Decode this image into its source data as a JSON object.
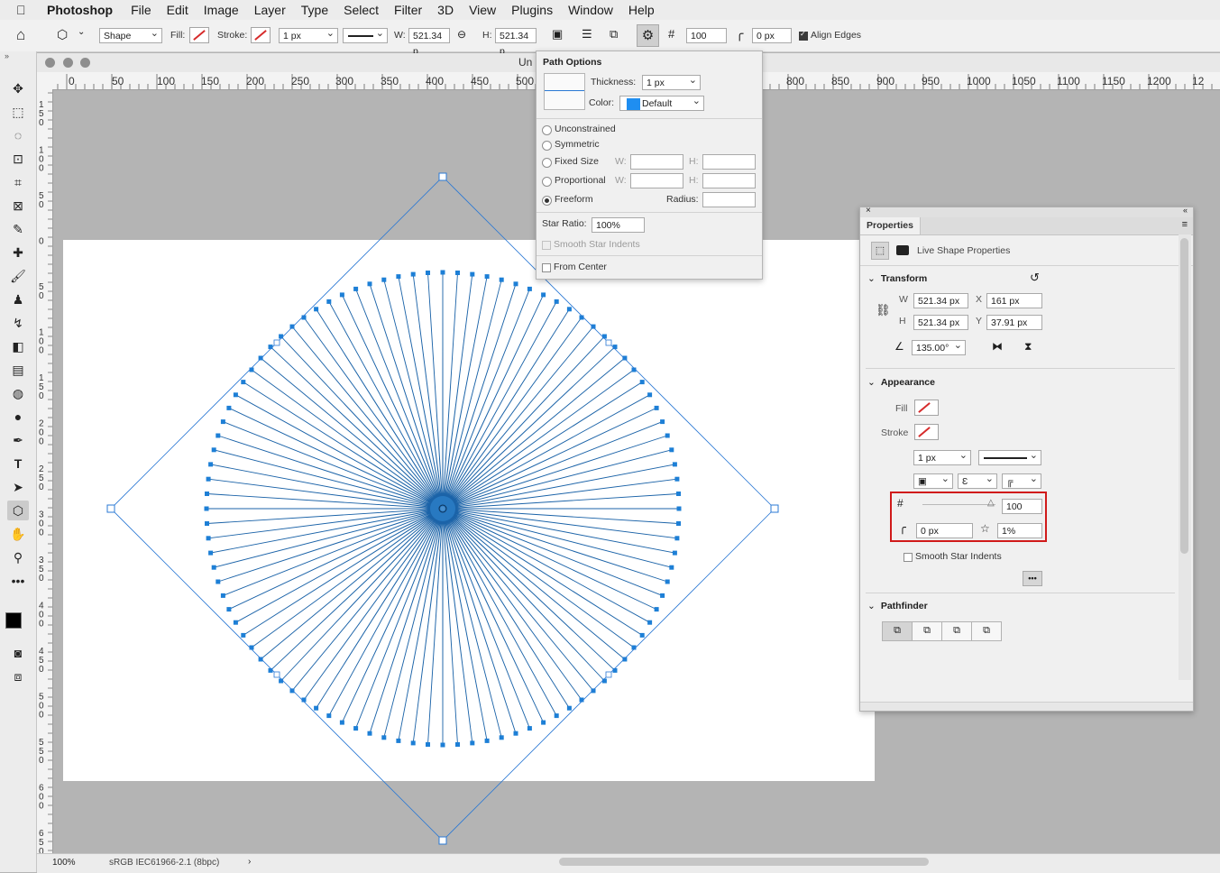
{
  "menubar": {
    "app": "Photoshop",
    "items": [
      "File",
      "Edit",
      "Image",
      "Layer",
      "Type",
      "Select",
      "Filter",
      "3D",
      "View",
      "Plugins",
      "Window",
      "Help"
    ]
  },
  "optbar": {
    "mode": "Shape",
    "fill_label": "Fill:",
    "stroke_label": "Stroke:",
    "stroke_width": "1 px",
    "w_label": "W:",
    "w_value": "521.34 p",
    "h_label": "H:",
    "h_value": "521.34 p",
    "points": "100",
    "radius": "0 px",
    "align_edges": "Align Edges"
  },
  "document": {
    "title": "Un",
    "ruler_h": [
      "0",
      "50",
      "100",
      "150",
      "200",
      "250",
      "300",
      "350",
      "400",
      "450",
      "500",
      "800",
      "850",
      "900",
      "950",
      "1000",
      "1050",
      "1100",
      "1150",
      "1200",
      "12"
    ],
    "ruler_v": [
      "1\n5\n0",
      "1\n0\n0",
      "5\n0",
      "0",
      "5\n0",
      "1\n0\n0",
      "1\n5\n0",
      "2\n0\n0",
      "2\n5\n0",
      "3\n0\n0",
      "3\n5\n0",
      "4\n0\n0",
      "4\n5\n0",
      "5\n0\n0",
      "5\n5\n0",
      "6\n0\n0",
      "6\n5\n0"
    ],
    "zoom": "100%",
    "profile": "sRGB IEC61966-2.1 (8bpc)",
    "shape_color": "#1b63a8",
    "bbox_color": "#2a78d4"
  },
  "path_options": {
    "title": "Path Options",
    "thickness_label": "Thickness:",
    "thickness": "1 px",
    "color_label": "Color:",
    "color": "Default",
    "color_swatch": "#1f8ef1",
    "unconstrained": "Unconstrained",
    "symmetric": "Symmetric",
    "fixed_size": "Fixed Size",
    "proportional": "Proportional",
    "freeform": "Freeform",
    "w": "W:",
    "h": "H:",
    "radius": "Radius:",
    "star_ratio_label": "Star Ratio:",
    "star_ratio": "100%",
    "smooth_star": "Smooth Star Indents",
    "from_center": "From Center"
  },
  "properties": {
    "tab": "Properties",
    "subtitle": "Live Shape Properties",
    "transform": "Transform",
    "w_label": "W",
    "w": "521.34 px",
    "h_label": "H",
    "h": "521.34 px",
    "x_label": "X",
    "x": "161 px",
    "y_label": "Y",
    "y": "37.91 px",
    "angle": "135.00°",
    "appearance": "Appearance",
    "fill": "Fill",
    "stroke": "Stroke",
    "stroke_width": "1 px",
    "points": "100",
    "slider_fraction": 1.0,
    "corner": "0 px",
    "star_ratio": "1%",
    "smooth_star": "Smooth Star Indents",
    "more": "•••",
    "pathfinder": "Pathfinder",
    "highlight_color": "#d01a1a"
  }
}
